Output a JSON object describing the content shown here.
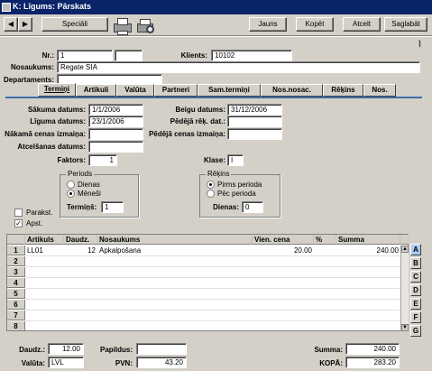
{
  "window": {
    "title": "K: Līgums: Pārskats"
  },
  "toolbar": {
    "prev_symbol": "◀",
    "next_symbol": "▶",
    "special_label": "Speciāli",
    "new_label": "Jauns",
    "copy_label": "Kopēt",
    "cancel_label": "Atcelt",
    "save_label": "Saglabāt"
  },
  "header": {
    "nr_label": "Nr.:",
    "nr_value": "1",
    "client_label": "Klients:",
    "client_value": "10102",
    "name_label": "Nosaukums:",
    "name_value": "Regate SIA",
    "dept_label": "Departaments:",
    "dept_value": ""
  },
  "tabs": [
    "Termiņi",
    "Artikuli",
    "Valūta",
    "Partneri",
    "Sam.termiņi",
    "Nos.nosac.",
    "Rēķins",
    "Nos."
  ],
  "terms": {
    "start_label": "Sākuma datums:",
    "start_value": "1/1/2006",
    "end_label": "Beigu datums:",
    "end_value": "31/12/2006",
    "contract_label": "Līguma datums:",
    "contract_value": "23/1/2006",
    "last_inv_label": "Pēdējā rēķ. dat.:",
    "last_inv_value": "",
    "next_price_label": "Nākamā cenas izmaiņa:",
    "next_price_value": "",
    "last_price_label": "Pēdējā cenas izmaiņa:",
    "last_price_value": "",
    "cancel_date_label": "Atcelšanas datums:",
    "cancel_date_value": "",
    "factor_label": "Faktors:",
    "factor_value": "1",
    "class_label": "Klase:",
    "class_value": "I"
  },
  "period": {
    "title": "Periods",
    "opt_days": "Dienas",
    "opt_months": "Mēneši",
    "term_label": "Termiņš:",
    "term_value": "1"
  },
  "invoice": {
    "title": "Rēķins",
    "opt_before": "Pirms perioda",
    "opt_after": "Pēc perioda",
    "days_label": "Dienas:",
    "days_value": "0"
  },
  "checks": {
    "signed_label": "Parakst.",
    "approved_label": "Apst."
  },
  "grid": {
    "headers": [
      "Artikuls",
      "Daudz.",
      "Nosaukums",
      "Vien. cena",
      "%",
      "Summa"
    ],
    "row_numbers": [
      "1",
      "2",
      "3",
      "4",
      "5",
      "6",
      "7",
      "8"
    ],
    "rows": [
      {
        "item": "LL01",
        "qty": "12",
        "name": "Apkalpošana",
        "price": "20.00",
        "pct": "",
        "sum": "240.00"
      }
    ],
    "side_letters": [
      "A",
      "B",
      "C",
      "D",
      "E",
      "F",
      "G"
    ]
  },
  "footer": {
    "qty_label": "Daudz.:",
    "qty_value": "12.00",
    "currency_label": "Valūta:",
    "currency_value": "LVL",
    "extra_label": "Papildus:",
    "extra_value": "",
    "vat_label": "PVN:",
    "vat_value": "43.20",
    "sum_label": "Summa:",
    "sum_value": "240.00",
    "total_label": "KOPĀ:",
    "total_value": "283.20"
  }
}
